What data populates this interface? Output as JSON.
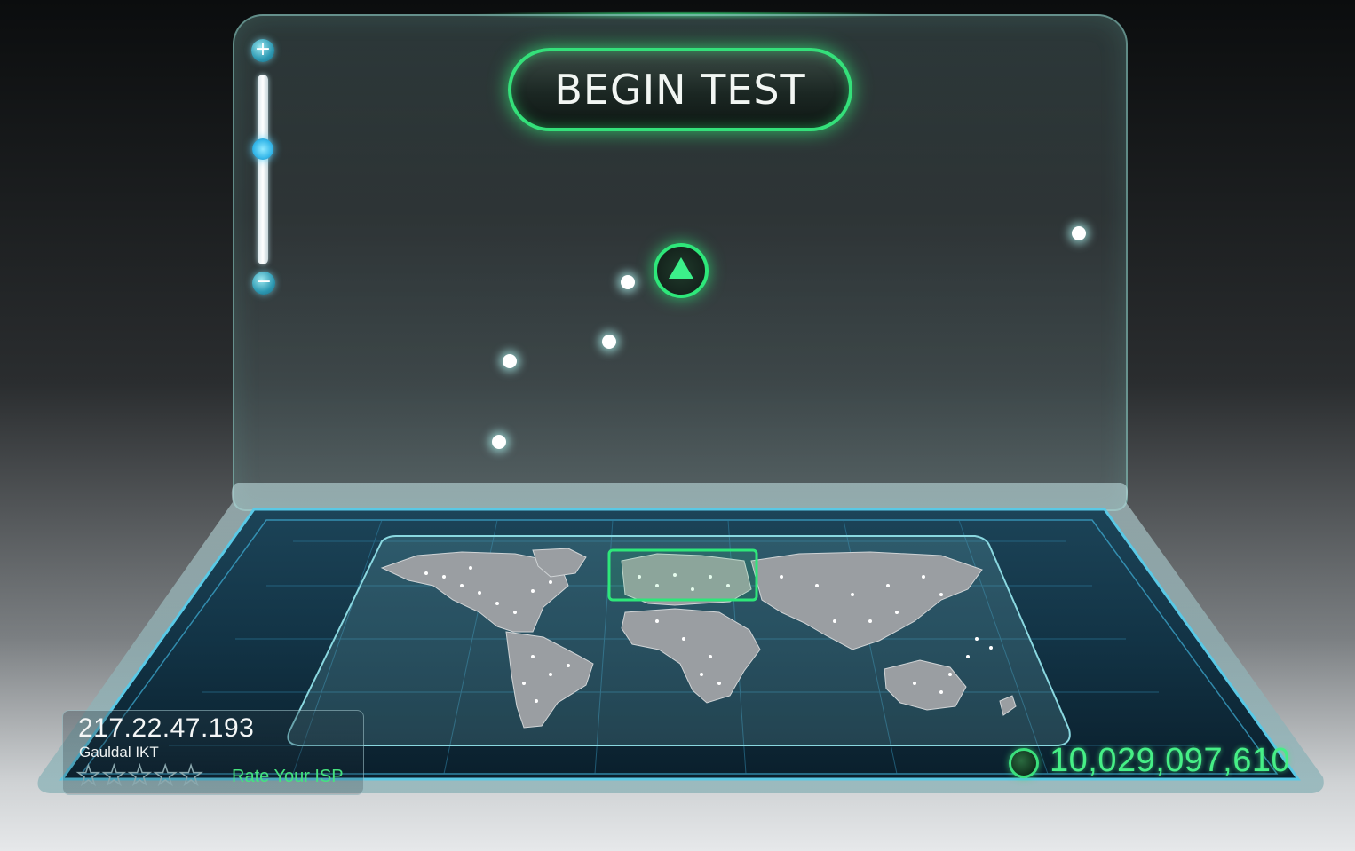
{
  "begin_test": {
    "label": "BEGIN TEST"
  },
  "zoom": {
    "plus_label": "+",
    "minus_label": "−",
    "level": 0.5
  },
  "isp": {
    "ip": "217.22.47.193",
    "name": "Gauldal IKT",
    "rating_stars_total": 5,
    "rating_stars_filled": 0,
    "rate_label": "Rate Your ISP"
  },
  "tests_counter": {
    "value": "10,029,097,610",
    "icon": "globe-icon"
  },
  "colors": {
    "accent_green": "#2ee77a",
    "slider_blue": "#36b8ea",
    "panel_edge": "#8cd2c8"
  }
}
